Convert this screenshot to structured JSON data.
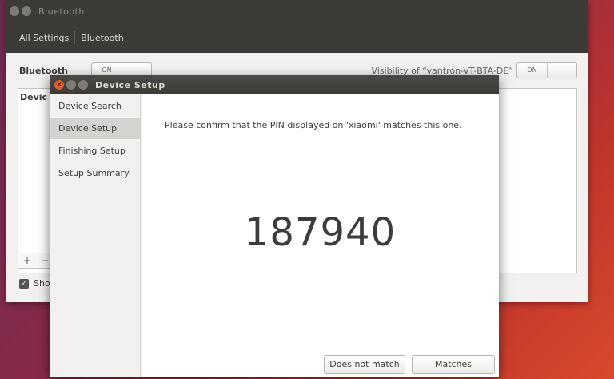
{
  "bt_window": {
    "title": "Bluetooth",
    "breadcrumb": [
      "All Settings",
      "Bluetooth"
    ],
    "bluetooth_label": "Bluetooth",
    "bluetooth_toggle": "ON",
    "visibility_label": "Visibility of “vantron-VT-BTA-DE”",
    "visibility_toggle": "ON",
    "devices_header": "Devic",
    "add_label": "+",
    "remove_label": "−",
    "show_label": "Sho"
  },
  "dialog": {
    "title": "Device Setup",
    "close_icon": "×",
    "steps": [
      {
        "label": "Device Search"
      },
      {
        "label": "Device Setup"
      },
      {
        "label": "Finishing Setup"
      },
      {
        "label": "Setup Summary"
      }
    ],
    "active_step": "Device Setup",
    "message": "Please confirm that the PIN displayed on 'xiaomi' matches this one.",
    "pin": "187940",
    "buttons": {
      "no_match": "Does not match",
      "match": "Matches"
    }
  },
  "colors": {
    "titlebar": "#3c3b37",
    "close_button": "#e25a2c",
    "active_step": "#d5d3cf",
    "desktop_gradient_start": "#6b2a4e",
    "desktop_gradient_end": "#d9492c"
  }
}
